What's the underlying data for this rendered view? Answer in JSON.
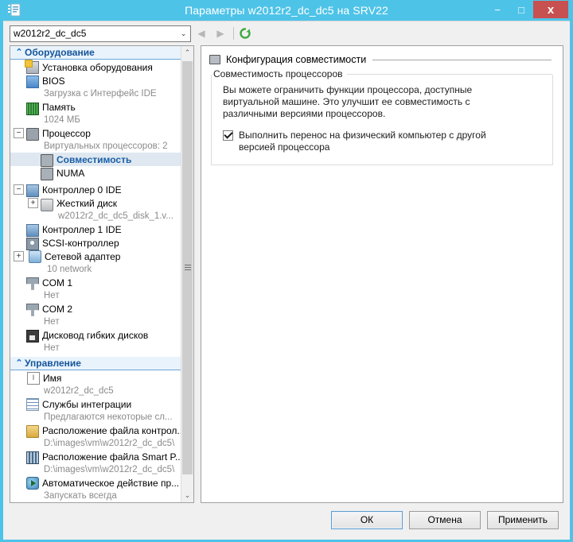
{
  "window": {
    "title": "Параметры w2012r2_dc_dc5 на SRV22",
    "icon": "vm-settings-icon",
    "controls": {
      "minimize": "−",
      "maximize": "□",
      "close": "x"
    }
  },
  "toolbar": {
    "vm_selector_value": "w2012r2_dc_dc5",
    "vm_selector_arrow": "⌄",
    "back_icon": "◀",
    "forward_icon": "▶",
    "refresh_icon": "refresh-icon"
  },
  "sidebar": {
    "scroll": {
      "up_arrow": "⌃",
      "down_arrow": "⌄"
    },
    "sections": [
      {
        "id": "hardware",
        "chevron": "⌃",
        "title": "Оборудование",
        "items": [
          {
            "label": "Установка оборудования",
            "icon": "add-hardware-icon",
            "indent": 0,
            "expander": "none",
            "sub": null,
            "selected": false
          },
          {
            "label": "BIOS",
            "icon": "bios-icon",
            "indent": 0,
            "expander": "none",
            "sub": "Загрузка с Интерфейс IDE",
            "selected": false
          },
          {
            "label": "Память",
            "icon": "memory-icon",
            "indent": 0,
            "expander": "none",
            "sub": "1024 МБ",
            "selected": false
          },
          {
            "label": "Процессор",
            "icon": "processor-icon",
            "indent": 0,
            "expander": "minus",
            "sub": "Виртуальных процессоров: 2",
            "selected": false
          },
          {
            "label": "Совместимость",
            "icon": "compatibility-icon",
            "indent": 1,
            "expander": "none",
            "sub": null,
            "selected": true
          },
          {
            "label": "NUMA",
            "icon": "numa-icon",
            "indent": 1,
            "expander": "none",
            "sub": null,
            "selected": false
          },
          {
            "label": "Контроллер 0 IDE",
            "icon": "ide-controller-icon",
            "indent": 0,
            "expander": "minus",
            "sub": null,
            "selected": false
          },
          {
            "label": "Жесткий диск",
            "icon": "hard-disk-icon",
            "indent": 1,
            "expander": "plus",
            "sub": "w2012r2_dc_dc5_disk_1.v...",
            "selected": false
          },
          {
            "label": "Контроллер 1 IDE",
            "icon": "ide-controller-icon",
            "indent": 0,
            "expander": "none",
            "sub": null,
            "selected": false
          },
          {
            "label": "SCSI-контроллер",
            "icon": "scsi-controller-icon",
            "indent": 0,
            "expander": "none",
            "sub": null,
            "selected": false
          },
          {
            "label": "Сетевой адаптер",
            "icon": "network-adapter-icon",
            "indent": 0,
            "expander": "plus",
            "sub": "10 network",
            "selected": false
          },
          {
            "label": "COM 1",
            "icon": "com-port-icon",
            "indent": 0,
            "expander": "none",
            "sub": "Нет",
            "selected": false
          },
          {
            "label": "COM 2",
            "icon": "com-port-icon",
            "indent": 0,
            "expander": "none",
            "sub": "Нет",
            "selected": false
          },
          {
            "label": "Дисковод гибких дисков",
            "icon": "floppy-drive-icon",
            "indent": 0,
            "expander": "none",
            "sub": "Нет",
            "selected": false
          }
        ]
      },
      {
        "id": "management",
        "chevron": "⌃",
        "title": "Управление",
        "items": [
          {
            "label": "Имя",
            "icon": "name-icon",
            "indent": 0,
            "expander": "none",
            "sub": "w2012r2_dc_dc5",
            "selected": false
          },
          {
            "label": "Службы интеграции",
            "icon": "integration-services-icon",
            "indent": 0,
            "expander": "none",
            "sub": "Предлагаются некоторые сл...",
            "selected": false
          },
          {
            "label": "Расположение файла контрол...",
            "icon": "checkpoint-folder-icon",
            "indent": 0,
            "expander": "none",
            "sub": "D:\\images\\vm\\w2012r2_dc_dc5\\",
            "selected": false
          },
          {
            "label": "Расположение файла Smart P...",
            "icon": "smart-paging-icon",
            "indent": 0,
            "expander": "none",
            "sub": "D:\\images\\vm\\w2012r2_dc_dc5\\",
            "selected": false
          },
          {
            "label": "Автоматическое действие пр...",
            "icon": "auto-start-action-icon",
            "indent": 0,
            "expander": "none",
            "sub": "Запускать всегда",
            "selected": false
          }
        ]
      }
    ]
  },
  "main": {
    "page_title": "Конфигурация совместимости",
    "group": {
      "legend": "Совместимость процессоров",
      "description": "Вы можете ограничить функции процессора, доступные виртуальной машине. Это улучшит ее совместимость с различными версиями процессоров.",
      "checkbox_label": "Выполнить перенос на физический компьютер с другой версией процессора",
      "checkbox_checked": true
    }
  },
  "footer": {
    "ok": "ОК",
    "cancel": "Отмена",
    "apply": "Применить"
  },
  "colors": {
    "titlebar": "#4ec3e8",
    "close_button": "#c75050",
    "section_header_text": "#15559a",
    "selected_item_text": "#1a5fa8",
    "selected_item_bg": "#dfe8f0"
  }
}
